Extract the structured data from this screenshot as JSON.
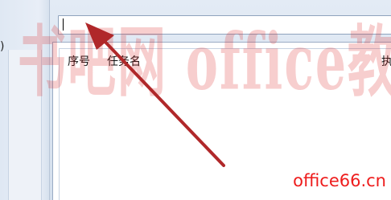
{
  "left_pane": {
    "fragment_text": ")"
  },
  "task_input": {
    "value": ""
  },
  "task_list": {
    "columns": [
      "序号",
      "任务名",
      "执"
    ]
  },
  "watermark": {
    "text": "书吧网 office教程网",
    "site": "office66.cn",
    "color": "#ee1c1c"
  },
  "annotation": {
    "arrow_color": "#b0282a"
  }
}
